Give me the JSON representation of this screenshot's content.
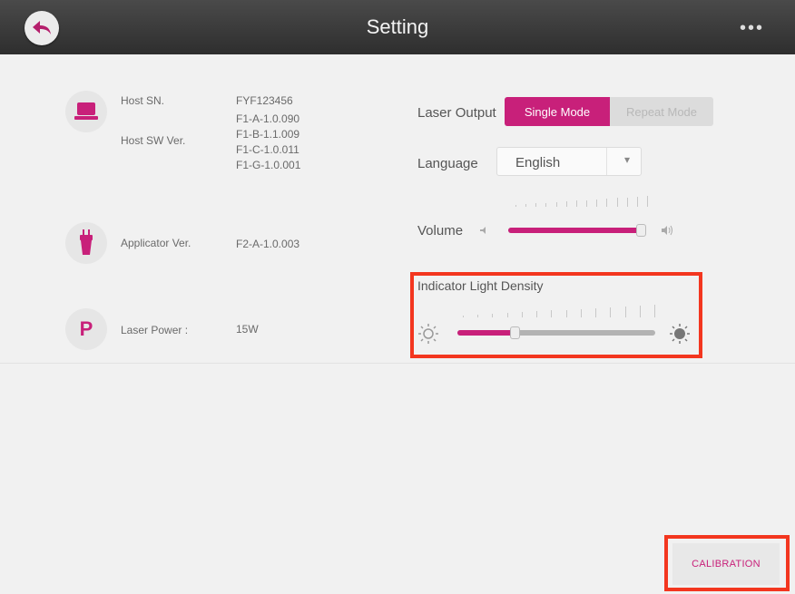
{
  "header": {
    "title": "Setting",
    "more": "•••"
  },
  "info": {
    "host_sn_label": "Host SN.",
    "host_sn_value": "FYF123456",
    "host_sw_label": "Host SW Ver.",
    "host_sw_values": [
      "F1-A-1.0.090",
      "F1-B-1.1.009",
      "F1-C-1.0.011",
      "F1-G-1.0.001"
    ],
    "applicator_label": "Applicator Ver.",
    "applicator_value": "F2-A-1.0.003",
    "laser_power_icon": "P",
    "laser_power_label": "Laser Power :",
    "laser_power_value": "15W"
  },
  "laser_output": {
    "label": "Laser Output",
    "options": [
      "Single Mode",
      "Repeat Mode"
    ],
    "selected": "Single Mode"
  },
  "language": {
    "label": "Language",
    "selected": "English",
    "arrow": "▾"
  },
  "volume": {
    "label": "Volume",
    "level": 0.97
  },
  "indicator": {
    "label": "Indicator Light Density",
    "level": 0.29
  },
  "calibration": {
    "label": "CALIBRATION"
  },
  "colors": {
    "accent": "#c8207a",
    "header": "#3a3a3a",
    "highlight": "#f3361f"
  }
}
